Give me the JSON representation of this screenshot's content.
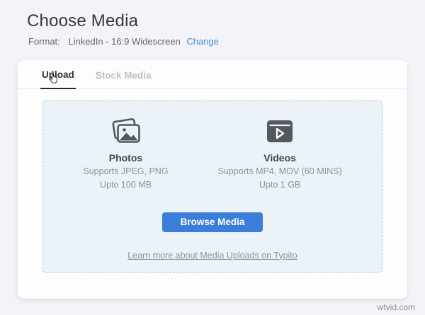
{
  "page": {
    "title": "Choose Media",
    "format_label": "Format:",
    "format_value": "LinkedIn - 16:9 Widescreen",
    "change_link": "Change",
    "watermark": "wtvid.com"
  },
  "tabs": [
    {
      "label": "Upload",
      "active": true
    },
    {
      "label": "Stock Media",
      "active": false
    }
  ],
  "dropzone": {
    "photos": {
      "title": "Photos",
      "line1": "Supports JPEG, PNG",
      "line2": "Upto 100 MB",
      "icon": "photos-stack-icon"
    },
    "videos": {
      "title": "Videos",
      "line1": "Supports MP4, MOV (60 MINS)",
      "line2": "Upto 1 GB",
      "icon": "video-play-icon"
    },
    "browse_button": "Browse Media",
    "learn_more": "Learn more about Media Uploads on Typito"
  },
  "colors": {
    "button_blue": "#3b7ed9",
    "link_blue": "#4a90d9",
    "dropzone_bg": "#ebf2f8",
    "dropzone_border": "#afc8db",
    "icon_gray": "#53585e",
    "page_bg": "#f4f3f8"
  }
}
